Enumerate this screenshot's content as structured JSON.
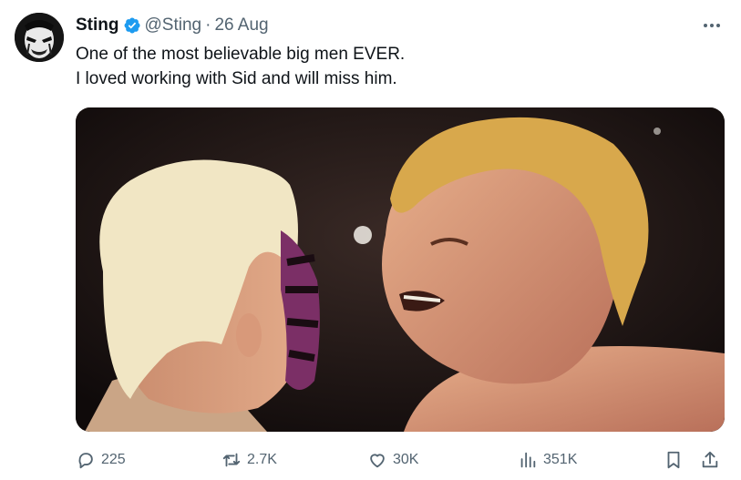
{
  "tweet": {
    "display_name": "Sting",
    "handle": "@Sting",
    "separator": "·",
    "date": "26 Aug",
    "text_line1": "One of the most believable big men EVER.",
    "text_line2": "I loved working with Sid and will miss him."
  },
  "icons": {
    "avatar": "profile-avatar-face-paint",
    "verified": "verified-badge-icon",
    "more": "more-options-icon",
    "reply": "reply-icon",
    "retweet": "retweet-icon",
    "like": "heart-icon",
    "views": "views-bar-chart-icon",
    "bookmark": "bookmark-icon",
    "share": "share-icon"
  },
  "actions": {
    "replies": "225",
    "retweets": "2.7K",
    "likes": "30K",
    "views": "351K"
  },
  "colors": {
    "text_primary": "#0f1419",
    "text_secondary": "#536471",
    "verified_blue": "#1d9bf0"
  }
}
